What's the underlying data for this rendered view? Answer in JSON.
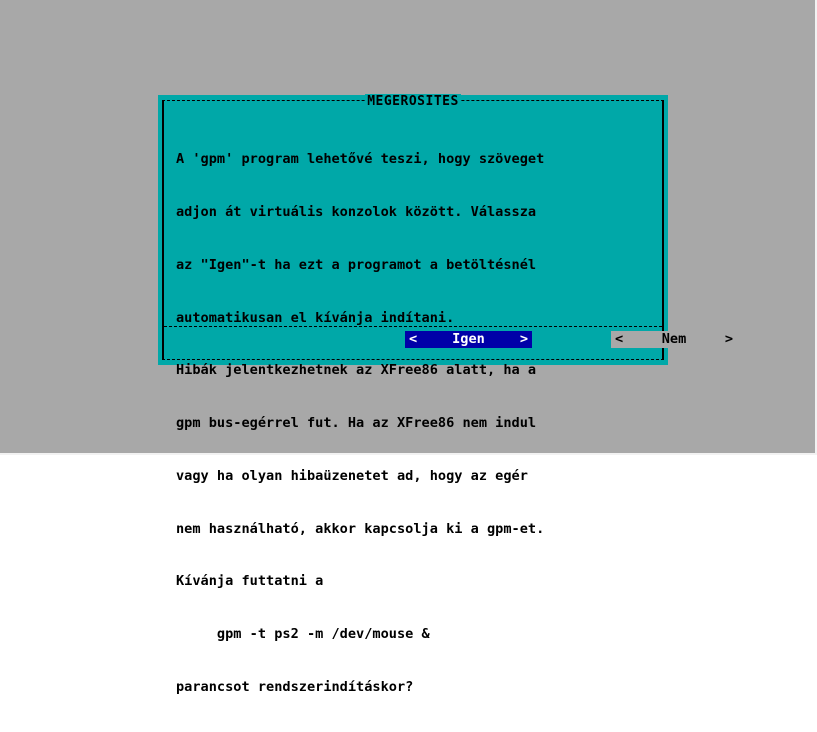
{
  "dialog": {
    "title": "MEGEROSITES",
    "lines": [
      "A 'gpm' program lehetővé teszi, hogy szöveget",
      "adjon át virtuális konzolok között. Válassza",
      "az \"Igen\"-t ha ezt a programot a betöltésnél",
      "automatikusan el kívánja indítani.",
      "Hibák jelentkezhetnek az XFree86 alatt, ha a",
      "gpm bus-egérrel fut. Ha az XFree86 nem indul",
      "vagy ha olyan hibaüzenetet ad, hogy az egér",
      "nem használható, akkor kapcsolja ki a gpm-et.",
      "Kívánja futtatni a",
      "     gpm -t ps2 -m /dev/mouse &",
      "parancsot rendszerindításkor?"
    ],
    "buttons": {
      "yes": {
        "label": "Igen",
        "left_arrow": "<",
        "right_arrow": ">"
      },
      "no": {
        "label": "Nem",
        "left_arrow": "<",
        "right_arrow": ">"
      }
    }
  },
  "colors": {
    "desktop": "#a8a8a8",
    "dialog_bg": "#00a8a8",
    "focused_button_bg": "#0000a8",
    "focused_button_fg": "#ffffff",
    "button_bg": "#a8a8a8",
    "text": "#000000"
  }
}
